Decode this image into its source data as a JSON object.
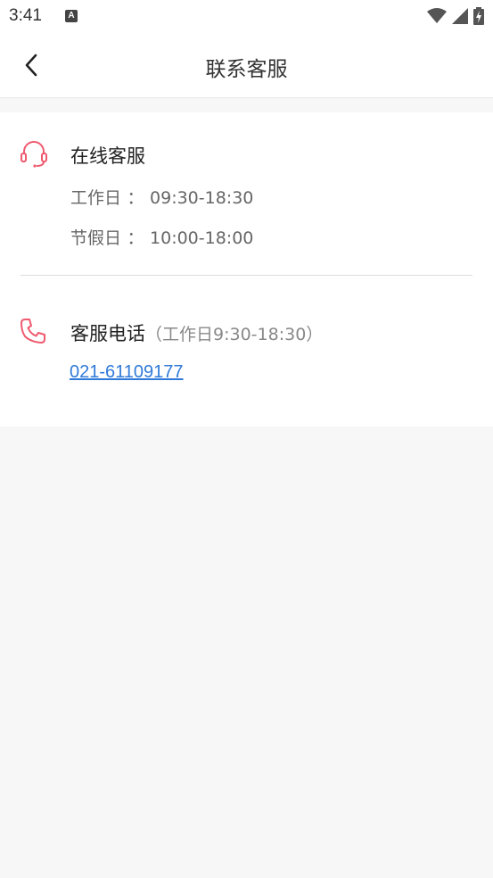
{
  "status_bar": {
    "time": "3:41",
    "notification_icon": "A"
  },
  "header": {
    "title": "联系客服",
    "back_icon": "chevron-left-icon"
  },
  "online_service": {
    "icon": "headset-icon",
    "title": "在线客服",
    "workday_label": "工作日",
    "workday_hours": "09:30-18:30",
    "holiday_label": "节假日",
    "holiday_hours": "10:00-18:00",
    "separator": "："
  },
  "phone_service": {
    "icon": "phone-icon",
    "title": "客服电话",
    "note": "（工作日9:30-18:30）",
    "number": "021-61109177"
  },
  "colors": {
    "accent_icon": "#ef5a6f",
    "link": "#2f7ad8",
    "background": "#f7f7f7"
  }
}
